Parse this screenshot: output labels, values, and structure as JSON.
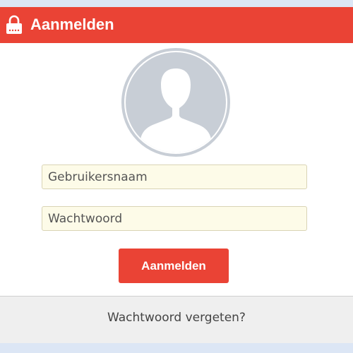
{
  "header": {
    "title": "Aanmelden",
    "icon": "lock-icon",
    "background_color": "#ea4335"
  },
  "avatar": {
    "icon": "user-avatar-icon"
  },
  "form": {
    "username_placeholder": "Gebruikersnaam",
    "password_placeholder": "Wachtwoord",
    "submit_label": "Aanmelden"
  },
  "footer": {
    "forgot_password_label": "Wachtwoord vergeten?"
  },
  "colors": {
    "accent": "#ea4335",
    "input_background": "#fdfbe8",
    "page_background": "#dce6f5",
    "footer_background": "#efefef"
  }
}
